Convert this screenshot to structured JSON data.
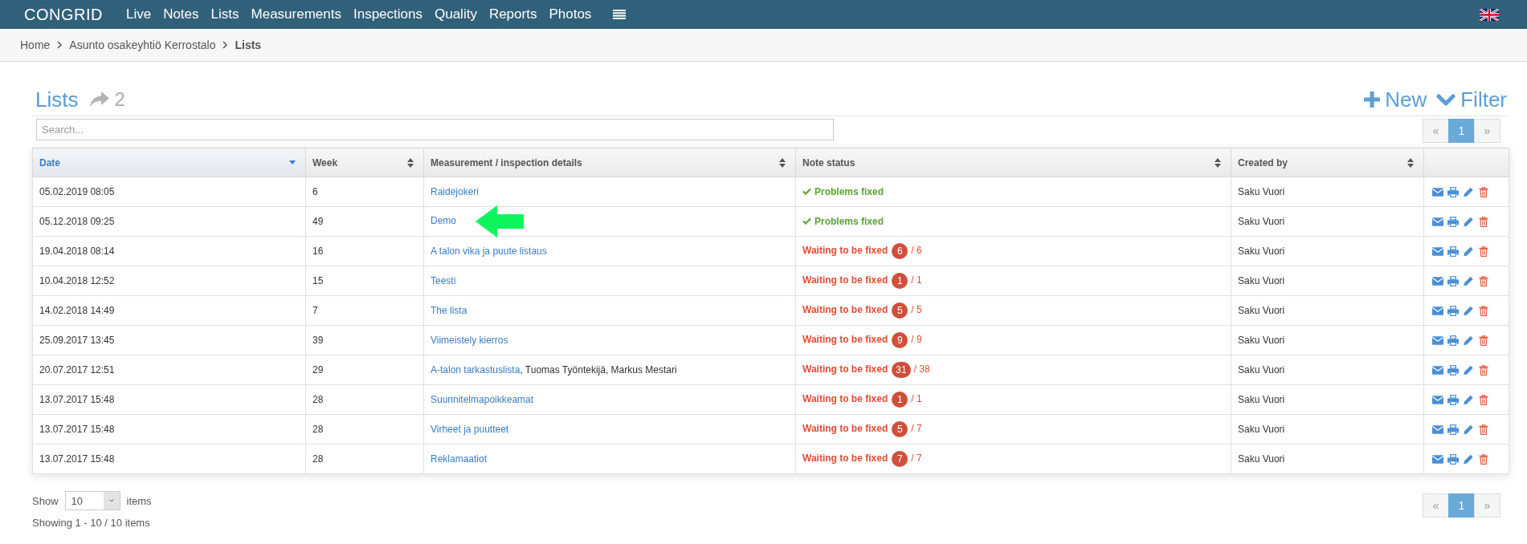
{
  "topbar": {
    "logo": "CONGRID",
    "nav": [
      {
        "label": "Live",
        "selected": false
      },
      {
        "label": "Notes",
        "selected": false
      },
      {
        "label": "Lists",
        "selected": false
      },
      {
        "label": "Measurements",
        "selected": false
      },
      {
        "label": "Inspections",
        "selected": false
      },
      {
        "label": "Quality",
        "selected": false
      },
      {
        "label": "Reports",
        "selected": false
      },
      {
        "label": "Photos",
        "selected": false
      }
    ]
  },
  "breadcrumb": [
    {
      "label": "Home",
      "current": false
    },
    {
      "label": "Asunto osakeyhtiö Kerrostalo",
      "current": false
    },
    {
      "label": "Lists",
      "current": true
    }
  ],
  "header": {
    "title": "Lists",
    "shared_count": "2",
    "actions": [
      {
        "kind": "new",
        "label": "New"
      },
      {
        "kind": "filter",
        "label": "Filter"
      }
    ]
  },
  "search": {
    "placeholder": "Search..."
  },
  "pagination_top": {
    "previous": "«",
    "pages": [
      {
        "label": "1",
        "selected": true
      }
    ],
    "next": "»"
  },
  "table": {
    "columns": [
      {
        "label": "Date",
        "selected": true
      },
      {
        "label": "Week",
        "selected": false
      },
      {
        "label": "Measurement / inspection details",
        "selected": false
      },
      {
        "label": "Note status",
        "selected": false
      },
      {
        "label": "Created by",
        "selected": false
      }
    ],
    "rows": [
      {
        "date": "05.02.2019 08:05",
        "week": "6",
        "title": "Raidejokeri",
        "pointer_arrow": false,
        "status": {
          "kind": "fixed",
          "label": "Problems fixed"
        },
        "created_by": "Saku Vuori"
      },
      {
        "date": "05.12.2018 09:25",
        "week": "49",
        "title": "Demo",
        "pointer_arrow": true,
        "status": {
          "kind": "fixed",
          "label": "Problems fixed"
        },
        "created_by": "Saku Vuori"
      },
      {
        "date": "19.04.2018 08:14",
        "week": "16",
        "title": "A talon vika ja puute listaus",
        "pointer_arrow": false,
        "status": {
          "kind": "waiting",
          "label": "Waiting to be fixed",
          "open": "6",
          "total": "/ 6"
        },
        "created_by": "Saku Vuori"
      },
      {
        "date": "10.04.2018 12:52",
        "week": "15",
        "title": "Teesti",
        "pointer_arrow": false,
        "status": {
          "kind": "waiting",
          "label": "Waiting to be fixed",
          "open": "1",
          "total": "/ 1"
        },
        "created_by": "Saku Vuori"
      },
      {
        "date": "14.02.2018 14:49",
        "week": "7",
        "title": "The lista",
        "pointer_arrow": false,
        "status": {
          "kind": "waiting",
          "label": "Waiting to be fixed",
          "open": "5",
          "total": "/ 5"
        },
        "created_by": "Saku Vuori"
      },
      {
        "date": "25.09.2017 13:45",
        "week": "39",
        "title": "Viimeistely kierros",
        "pointer_arrow": false,
        "status": {
          "kind": "waiting",
          "label": "Waiting to be fixed",
          "open": "9",
          "total": "/ 9"
        },
        "created_by": "Saku Vuori"
      },
      {
        "date": "20.07.2017 12:51",
        "week": "29",
        "title": "A-talon tarkastuslista",
        "participants": ", Tuomas Työntekijä, Markus Mestari",
        "pointer_arrow": false,
        "status": {
          "kind": "waiting",
          "label": "Waiting to be fixed",
          "open": "31",
          "total": "/ 38"
        },
        "created_by": "Saku Vuori"
      },
      {
        "date": "13.07.2017 15:48",
        "week": "28",
        "title": "Suunnitelmapoikkeamat",
        "pointer_arrow": false,
        "status": {
          "kind": "waiting",
          "label": "Waiting to be fixed",
          "open": "1",
          "total": "/ 1"
        },
        "created_by": "Saku Vuori"
      },
      {
        "date": "13.07.2017 15:48",
        "week": "28",
        "title": "Virheet ja puutteet",
        "pointer_arrow": false,
        "status": {
          "kind": "waiting",
          "label": "Waiting to be fixed",
          "open": "5",
          "total": "/ 7"
        },
        "created_by": "Saku Vuori"
      },
      {
        "date": "13.07.2017 15:48",
        "week": "28",
        "title": "Reklamaatiot",
        "pointer_arrow": false,
        "status": {
          "kind": "waiting",
          "label": "Waiting to be fixed",
          "open": "7",
          "total": "/ 7"
        },
        "created_by": "Saku Vuori"
      }
    ]
  },
  "footer": {
    "show_label": "Show",
    "page_size": "10",
    "items_label": "items",
    "summary": "Showing 1 - 10 / 10 items"
  },
  "pagination_bottom": {
    "previous": "«",
    "pages": [
      {
        "label": "1",
        "selected": true
      }
    ],
    "next": "»"
  }
}
